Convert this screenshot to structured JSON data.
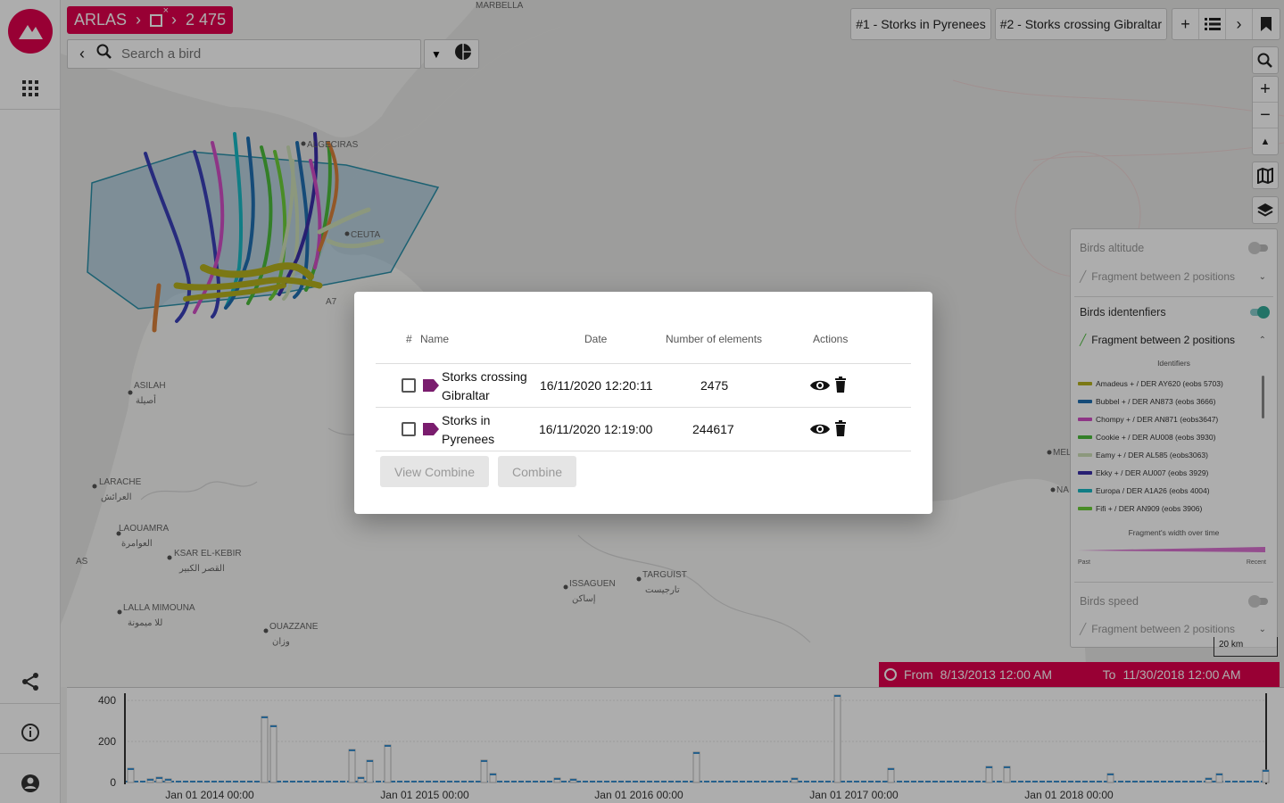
{
  "header": {
    "app_name": "ARLAS",
    "count": "2 475"
  },
  "search": {
    "placeholder": "Search a bird"
  },
  "tabs": [
    {
      "label": "#1 - Storks in Pyrenees"
    },
    {
      "label": "#2 - Storks crossing Gibraltar"
    }
  ],
  "map_labels": {
    "marbella": "MARBELLA",
    "algeciras": "ALGECIRAS",
    "ceuta": "CEUTA",
    "a7": "A7",
    "asilah": "ASILAH",
    "asilah_ar": "أصيلة",
    "larache": "LARACHE",
    "larache_ar": "العرائش",
    "laouamra": "LAOUAMRA",
    "laouamra_ar": "العوامرة",
    "ksar": "KSAR EL-KEBIR",
    "ksar_ar": "القصر الكبير",
    "as": "AS",
    "lalla": "LALLA MIMOUNA",
    "lalla_ar": "للا ميمونة",
    "ouazzane": "OUAZZANE",
    "ouazzane_ar": "وزان",
    "issaguen": "ISSAGUEN",
    "issaguen_ar": "إساكن",
    "targuist": "TARGUIST",
    "targuist_ar": "تارجيست",
    "mel": "MEL",
    "na": "NA"
  },
  "legend": {
    "altitude_title": "Birds altitude",
    "altitude_fragment": "Fragment between 2 positions",
    "identifiers_title": "Birds identenfiers",
    "identifiers_fragment": "Fragment between 2 positions",
    "identifiers_header": "Identifiers",
    "items": [
      {
        "label": "Amadeus + / DER AY620 (eobs 5703)",
        "color": "#b5b21e"
      },
      {
        "label": "Bubbel + / DER AN873 (eobs 3666)",
        "color": "#1f6fb2"
      },
      {
        "label": "Chompy + / DER AN871 (eobs3647)",
        "color": "#d14fc6"
      },
      {
        "label": "Cookie + / DER AU008 (eobs 3930)",
        "color": "#4cbc3c"
      },
      {
        "label": "Eamy + / DER AL585 (eobs3063)",
        "color": "#cfe0b8"
      },
      {
        "label": "Ekky + / DER AU007 (eobs 3929)",
        "color": "#3a2fa8"
      },
      {
        "label": "Europa / DER A1A26 (eobs 4004)",
        "color": "#19b8c4"
      },
      {
        "label": "Fifi + / DER AN909 (eobs 3906)",
        "color": "#6ccf3a"
      }
    ],
    "width_title": "Fragment's width over time",
    "past": "Past",
    "recent": "Recent",
    "speed_title": "Birds speed",
    "speed_fragment": "Fragment between 2 positions"
  },
  "scale": "20 km",
  "time_range": {
    "from_label": "From",
    "from_value": "8/13/2013 12:00 AM",
    "to_label": "To",
    "to_value": "11/30/2018 12:00 AM"
  },
  "timeline": {
    "y_ticks": [
      "400",
      "200",
      "0"
    ],
    "x_ticks": [
      "Jan 01 2014 00:00",
      "Jan 01 2015 00:00",
      "Jan 01 2016 00:00",
      "Jan 01 2017 00:00",
      "Jan 01 2018 00:00"
    ]
  },
  "dialog": {
    "col_num": "#",
    "col_name": "Name",
    "col_date": "Date",
    "col_count": "Number of elements",
    "col_actions": "Actions",
    "rows": [
      {
        "name_line1": "Storks crossing",
        "name_line2": "Gibraltar",
        "date": "16/11/2020 12:20:11",
        "count": "2475"
      },
      {
        "name_line1": "Storks in",
        "name_line2": "Pyrenees",
        "date": "16/11/2020 12:19:00",
        "count": "244617"
      }
    ],
    "view_combine": "View Combine",
    "combine": "Combine"
  },
  "colors": {
    "brand": "#e0004d",
    "tag": "#7a1d6e",
    "polygon": "#2a8fa8"
  }
}
